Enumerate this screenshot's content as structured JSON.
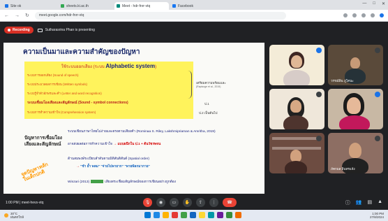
{
  "browser": {
    "tabs": [
      {
        "label": "Site ok",
        "color": "#1a73e8",
        "active": false
      },
      {
        "label": "sheets.ki.ac.th",
        "color": "#34a853",
        "active": false
      },
      {
        "label": "Meet - hdr-fnrr-vtq",
        "color": "#00897b",
        "active": true
      },
      {
        "label": "Facebook",
        "color": "#1877f2",
        "active": false
      }
    ],
    "url": "meet.google.com/hdr-fnrr-vtq",
    "window_controls": [
      "—",
      "□",
      "✕"
    ]
  },
  "meet": {
    "recording_label": "Recording",
    "presenter_text": "Sutharasrina Phan is presenting"
  },
  "slide": {
    "title": "ความเป็นมาและความสำคัญของปัญหา",
    "box_heading_thai": "ใช้ระบบออกเสียง (ระบบ",
    "box_heading_en": "Alphabetic system",
    "box_heading_close": ")",
    "rows": [
      {
        "text": "ระบบการออกเสียง (Sound of speech)",
        "bold": false
      },
      {
        "text": "ระบบประมวลผลการเขียน (Written symbols)",
        "bold": false
      },
      {
        "text": "ระบบรู้จำตัวอักษรและคำ (Letter and word recognition)",
        "bold": false
      },
      {
        "text": "ระบบเชื่อมโยงเสียงและสัญลักษณ์ (Sound - symbol connections)",
        "bold": true
      },
      {
        "text": "ระบบการทำความเข้าใจ (Comprehension system)",
        "bold": false
      }
    ],
    "side_notes": {
      "n1": "เตรียมความพร้อมและ",
      "n1b": "(Rapisoge et al., 2019)",
      "n2": "ป.1",
      "n3": "ป.2 เป็นต้นไป"
    },
    "left_label": [
      "ปัญหาการเชื่อมโยง",
      "เสียงและสัญลักษณ์"
    ],
    "lines": [
      "ระบบเขียนภาษาไทยไม่ง่ายและตรงตามเสียงคำ (Rominaa S. Riley, Lakshmipriaman & Amritha, 2019)",
      "อาจส่งผลต่อการทำความเข้าใจ",
      "แบบผนึกใน ป.1 + ต้นวัชรพจน",
      "ด้านสมพงษ์ระเบียบลำดับตามมิติสันติสันต์ (Spatial order)",
      "\"ชำ ย้ำ พลม\" \"จ่ายไปพายาก\" \"พายพ้ลกมากาย\"",
      "Winzari (2013)",
      "เสียงสระเชื่อมสัญลักษณ์ของการเขียนอย่างถูกต้อง"
    ],
    "handwritten": [
      "จุดปัญหาหลัก",
      "ในเด็กปกติ"
    ]
  },
  "participants": [
    {
      "name": "",
      "bg": "#f4ecd8",
      "shirt": "#d7ccc8",
      "speaking": true
    },
    {
      "name": "วรรณ์พิน ภูโคนะ",
      "bg": "#5a4a3a",
      "shirt": "#263238",
      "speaking": false
    },
    {
      "name": "",
      "bg": "#efe7da",
      "shirt": "#4e342e",
      "speaking": false
    },
    {
      "name": "",
      "bg": "#c8b8a4",
      "shirt": "#c2185b",
      "speaking": true
    },
    {
      "name": "",
      "bg": "#6d4c41",
      "shirt": "#3e2723",
      "speaking": false
    },
    {
      "name": "ภัคกมล อินทรแจ้ง",
      "bg": "#8d6e63",
      "shirt": "#212121",
      "speaking": false
    }
  ],
  "controls": {
    "time_label": "1:00 PM | meet-hevs-vtq",
    "buttons": [
      "mic",
      "cam",
      "cc",
      "hand",
      "present",
      "more",
      "end"
    ]
  },
  "taskbar": {
    "weather_temp": "30°C",
    "weather_desc": "ฝนตกใกล้",
    "time": "1:00 PM",
    "date": "27/8/2024",
    "app_colors": [
      "#0078d4",
      "#1e88e5",
      "#ffb300",
      "#e53935",
      "#43a047",
      "#1565c0",
      "#fdd835",
      "#0097a7",
      "#6a1b9a",
      "#388e3c",
      "#ef6c00"
    ]
  }
}
